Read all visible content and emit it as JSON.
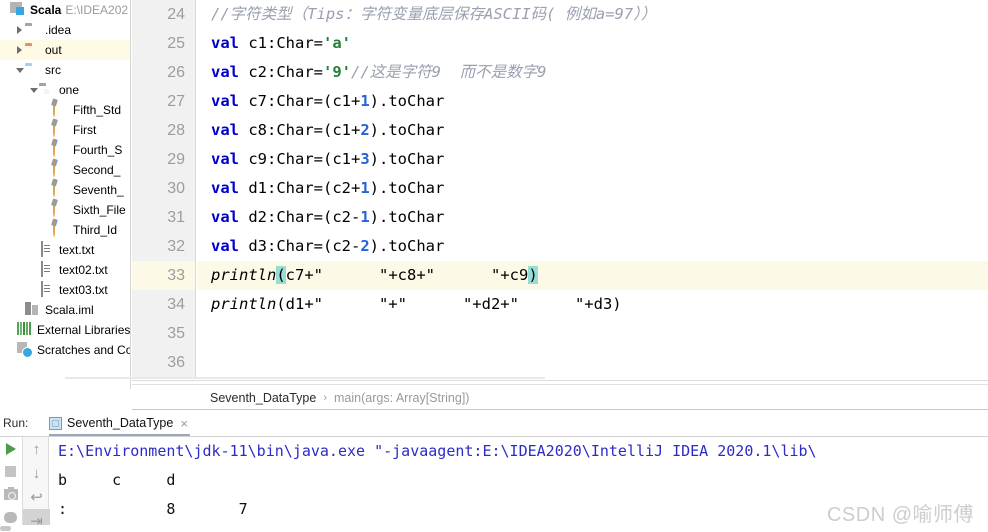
{
  "project": {
    "root_label": "Scala",
    "root_path": "E:\\IDEA202",
    "items": [
      {
        "label": ".idea",
        "icon": "folder-grey-icon",
        "arrow": "right",
        "indent": 0,
        "selected": false
      },
      {
        "label": "out",
        "icon": "folder-orange-icon",
        "arrow": "right",
        "indent": 0,
        "selected": true
      },
      {
        "label": "src",
        "icon": "folder-blue-icon",
        "arrow": "down",
        "indent": 0,
        "selected": false
      },
      {
        "label": "one",
        "icon": "package-folder-icon",
        "arrow": "down",
        "indent": 1,
        "selected": false
      },
      {
        "label": "Fifth_Std",
        "icon": "scala-object-icon",
        "arrow": "none",
        "indent": 2,
        "selected": false
      },
      {
        "label": "First",
        "icon": "scala-object-icon",
        "arrow": "none",
        "indent": 2,
        "selected": false
      },
      {
        "label": "Fourth_S",
        "icon": "scala-object-icon",
        "arrow": "none",
        "indent": 2,
        "selected": false
      },
      {
        "label": "Second_",
        "icon": "scala-object-icon",
        "arrow": "none",
        "indent": 2,
        "selected": false
      },
      {
        "label": "Seventh_",
        "icon": "scala-object-icon",
        "arrow": "none",
        "indent": 2,
        "selected": false
      },
      {
        "label": "Sixth_File",
        "icon": "scala-object-icon",
        "arrow": "none",
        "indent": 2,
        "selected": false
      },
      {
        "label": "Third_Id",
        "icon": "scala-object-icon",
        "arrow": "none",
        "indent": 2,
        "selected": false
      },
      {
        "label": "text.txt",
        "icon": "text-file-icon",
        "arrow": "none",
        "indent": 1,
        "selected": false
      },
      {
        "label": "text02.txt",
        "icon": "text-file-icon",
        "arrow": "none",
        "indent": 1,
        "selected": false
      },
      {
        "label": "text03.txt",
        "icon": "text-file-icon",
        "arrow": "none",
        "indent": 1,
        "selected": false
      },
      {
        "label": "Scala.iml",
        "icon": "iml-file-icon",
        "arrow": "none",
        "indent": 0,
        "selected": false
      },
      {
        "label": "External Libraries",
        "icon": "external-libraries-icon",
        "arrow": "none",
        "indent": -1,
        "selected": false
      },
      {
        "label": "Scratches and Co",
        "icon": "scratches-icon",
        "arrow": "none",
        "indent": -1,
        "selected": false
      }
    ]
  },
  "editor": {
    "line_numbers": [
      "24",
      "25",
      "26",
      "27",
      "28",
      "29",
      "30",
      "31",
      "32",
      "33",
      "34",
      "35",
      "36"
    ],
    "current_line": "33",
    "lines": [
      {
        "n": "24",
        "tokens": [
          {
            "t": "//字符类型（Tips：字符变量底层保存ASCII码( 例如a=97））",
            "c": "cmt"
          }
        ]
      },
      {
        "n": "25",
        "tokens": [
          {
            "t": "val",
            "c": "kw"
          },
          {
            "t": " c1:Char=",
            "c": ""
          },
          {
            "t": "'a'",
            "c": "str"
          }
        ]
      },
      {
        "n": "26",
        "tokens": [
          {
            "t": "val",
            "c": "kw"
          },
          {
            "t": " c2:Char=",
            "c": ""
          },
          {
            "t": "'9'",
            "c": "str"
          },
          {
            "t": "//这是字符9  而不是数字9",
            "c": "cmt"
          }
        ]
      },
      {
        "n": "27",
        "tokens": [
          {
            "t": "val",
            "c": "kw"
          },
          {
            "t": " c7:Char=(c1+",
            "c": ""
          },
          {
            "t": "1",
            "c": "num"
          },
          {
            "t": ").toChar",
            "c": ""
          }
        ]
      },
      {
        "n": "28",
        "tokens": [
          {
            "t": "val",
            "c": "kw"
          },
          {
            "t": " c8:Char=(c1+",
            "c": ""
          },
          {
            "t": "2",
            "c": "num"
          },
          {
            "t": ").toChar",
            "c": ""
          }
        ]
      },
      {
        "n": "29",
        "tokens": [
          {
            "t": "val",
            "c": "kw"
          },
          {
            "t": " c9:Char=(c1+",
            "c": ""
          },
          {
            "t": "3",
            "c": "num"
          },
          {
            "t": ").toChar",
            "c": ""
          }
        ]
      },
      {
        "n": "30",
        "tokens": [
          {
            "t": "val",
            "c": "kw"
          },
          {
            "t": " d1:Char=(c2+",
            "c": ""
          },
          {
            "t": "1",
            "c": "num"
          },
          {
            "t": ").toChar",
            "c": ""
          }
        ]
      },
      {
        "n": "31",
        "tokens": [
          {
            "t": "val",
            "c": "kw"
          },
          {
            "t": " d2:Char=(c2-",
            "c": ""
          },
          {
            "t": "1",
            "c": "num"
          },
          {
            "t": ").toChar",
            "c": ""
          }
        ]
      },
      {
        "n": "32",
        "tokens": [
          {
            "t": "val",
            "c": "kw"
          },
          {
            "t": " d3:Char=(c2-",
            "c": ""
          },
          {
            "t": "2",
            "c": "num"
          },
          {
            "t": ").toChar",
            "c": ""
          }
        ]
      },
      {
        "n": "33",
        "tokens": [
          {
            "t": "println",
            "c": "fn"
          },
          {
            "t": "(",
            "c": "selbr"
          },
          {
            "t": "c7+\"      \"+c8+\"      \"+c9",
            "c": ""
          },
          {
            "t": ")",
            "c": "selbr"
          }
        ]
      },
      {
        "n": "34",
        "tokens": [
          {
            "t": "println",
            "c": "fn"
          },
          {
            "t": "(d1+\"      \"+\"      \"+d2+\"      \"+d3)",
            "c": ""
          }
        ]
      },
      {
        "n": "35",
        "tokens": [
          {
            "t": "",
            "c": ""
          }
        ]
      },
      {
        "n": "36",
        "tokens": [
          {
            "t": "",
            "c": ""
          }
        ]
      }
    ]
  },
  "breadcrumb": {
    "object": "Seventh_DataType",
    "separator": "›",
    "method": "main(args: Array[String])"
  },
  "run_panel": {
    "label": "Run:",
    "tab_title": "Seventh_DataType",
    "tab_close": "×",
    "toolbar_left": [
      {
        "name": "rerun-button",
        "icon": "play-icon"
      },
      {
        "name": "stop-button",
        "icon": "stop-icon"
      },
      {
        "name": "dump-threads-button",
        "icon": "camera-icon"
      },
      {
        "name": "profile-button",
        "icon": "bug-icon"
      }
    ],
    "toolbar_right": [
      {
        "name": "scroll-up-button",
        "icon": "arrow-up-icon",
        "glyph": "↑",
        "selected": false
      },
      {
        "name": "scroll-down-button",
        "icon": "arrow-down-icon",
        "glyph": "↓",
        "selected": false
      },
      {
        "name": "soft-wrap-button",
        "icon": "soft-wrap-icon",
        "glyph": "↩",
        "selected": false
      },
      {
        "name": "scroll-to-end-button",
        "icon": "scroll-to-end-icon",
        "glyph": "⇥",
        "selected": true
      }
    ],
    "console": [
      {
        "text": "E:\\Environment\\jdk-11\\bin\\java.exe \"-javaagent:E:\\IDEA2020\\IntelliJ IDEA 2020.1\\lib\\",
        "kind": "cmd"
      },
      {
        "text": "b     c     d",
        "kind": "out"
      },
      {
        "text": ":           8       7",
        "kind": "out"
      }
    ]
  },
  "watermark": "CSDN @喻师傅"
}
